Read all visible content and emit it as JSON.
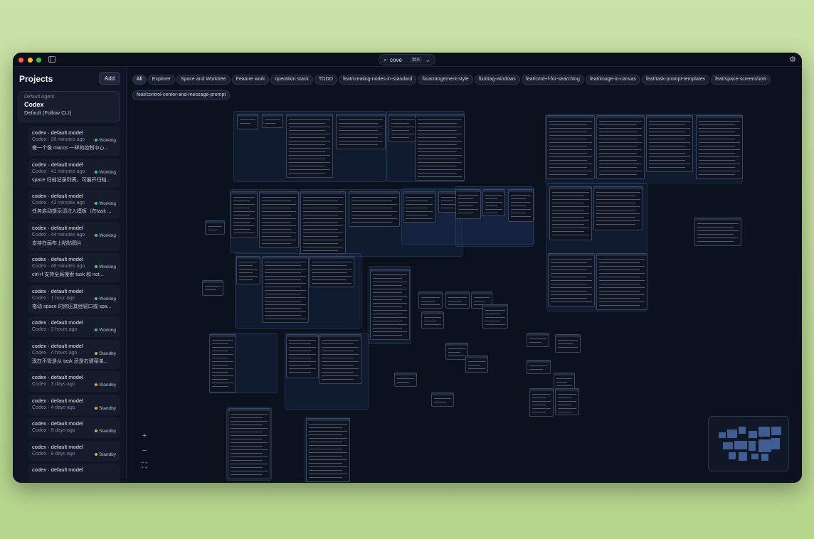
{
  "search": {
    "query": "cove",
    "shortcut": "⌘K"
  },
  "icons": {
    "search": "search-icon",
    "chevron": "chevron-down-icon",
    "gear": "gear-icon",
    "sidebar": "sidebar-toggle-icon"
  },
  "sidebar": {
    "title": "Projects",
    "add_label": "Add",
    "agent": {
      "kicker": "Default Agent",
      "name": "Codex",
      "sub": "Default (Follow CLI)"
    },
    "sessions": [
      {
        "title": "codex · default model",
        "meta": "Codex · 26 minutes ago",
        "status": "Working",
        "desc": "做一个像 macos 一样的控制中心..."
      },
      {
        "title": "codex · default model",
        "meta": "Codex · 41 minutes ago",
        "status": "Working",
        "desc": "space 归档记录列表，可展开归档..."
      },
      {
        "title": "codex · default model",
        "meta": "Codex · 42 minutes ago",
        "status": "Working",
        "desc": "任务启动提示词注入模板（在task ..."
      },
      {
        "title": "codex · default model",
        "meta": "Codex · 44 minutes ago",
        "status": "Working",
        "desc": "支持在画布上粘贴图片"
      },
      {
        "title": "codex · default model",
        "meta": "Codex · 46 minutes ago",
        "status": "Working",
        "desc": "ctrl+f 支持全局搜索 task 和 not..."
      },
      {
        "title": "codex · default model",
        "meta": "Codex · 1 hour ago",
        "status": "Working",
        "desc": "拖动 space 时挤压其他窗口或 spa..."
      },
      {
        "title": "codex · default model",
        "meta": "Codex · 3 hours ago",
        "status": "Working",
        "desc": ""
      },
      {
        "title": "codex · default model",
        "meta": "Codex · 4 hours ago",
        "status": "Standby",
        "desc": "现在不管是从 task 还是右键菜单..."
      },
      {
        "title": "codex · default model",
        "meta": "Codex · 3 days ago",
        "status": "Standby",
        "desc": ""
      },
      {
        "title": "codex · default model",
        "meta": "Codex · 4 days ago",
        "status": "Standby",
        "desc": ""
      },
      {
        "title": "codex · default model",
        "meta": "Codex · 8 days ago",
        "status": "Standby",
        "desc": ""
      },
      {
        "title": "codex · default model",
        "meta": "Codex · 9 days ago",
        "status": "Standby",
        "desc": ""
      },
      {
        "title": "codex · default model",
        "meta": "",
        "status": "",
        "desc": ""
      }
    ]
  },
  "colors": {
    "working": "#3ecf6e",
    "standby": "#e8a33a"
  },
  "tags": [
    "All",
    "Explorer",
    "Space and Worktree",
    "Feature work",
    "operation stack",
    "TODO",
    "feat/creating-nodes-in-standard",
    "fix/arrangement-style",
    "fix/drag-windows",
    "feat/cmd+f-for-searching",
    "feat/image-in-canvas",
    "feat/task-prompt-templates",
    "feat/space-screenshots",
    "feat/control-center-and-message-prompt"
  ],
  "zoom": {
    "in": "+",
    "out": "−",
    "fit": "⛶"
  }
}
